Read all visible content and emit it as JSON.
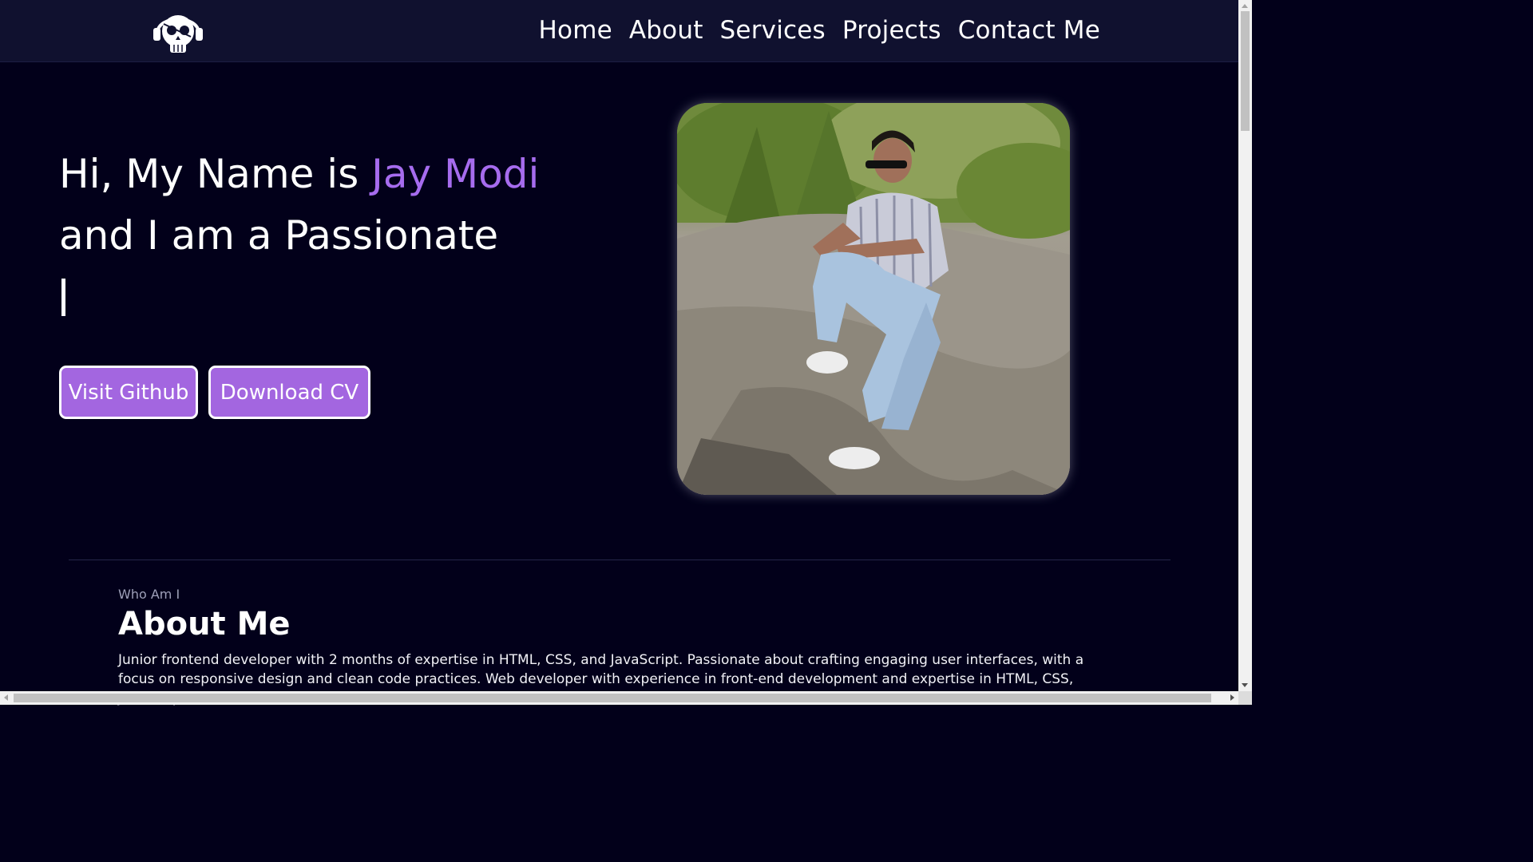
{
  "nav": {
    "logo_icon": "skull-headphones-icon",
    "links": [
      {
        "label": "Home"
      },
      {
        "label": "About"
      },
      {
        "label": "Services"
      },
      {
        "label": "Projects"
      },
      {
        "label": "Contact Me"
      }
    ]
  },
  "hero": {
    "greeting": "Hi, My Name is ",
    "name": "Jay Modi",
    "line2": "and I am a Passionate",
    "typed_text": "",
    "buttons": {
      "github": "Visit Github",
      "cv": "Download CV"
    },
    "photo_icon": "profile-photo"
  },
  "about": {
    "subtitle": "Who Am I",
    "title": "About Me",
    "text": "Junior frontend developer with 2 months of expertise in HTML, CSS, and JavaScript. Passionate about crafting engaging user interfaces, with a focus on responsive design and clean code practices. Web developer with experience in front-end development and expertise in HTML, CSS, JavaScript, and"
  },
  "colors": {
    "background": "#02001a",
    "navbar": "#10112f",
    "accent": "#a66cee",
    "button": "#a366e0"
  }
}
